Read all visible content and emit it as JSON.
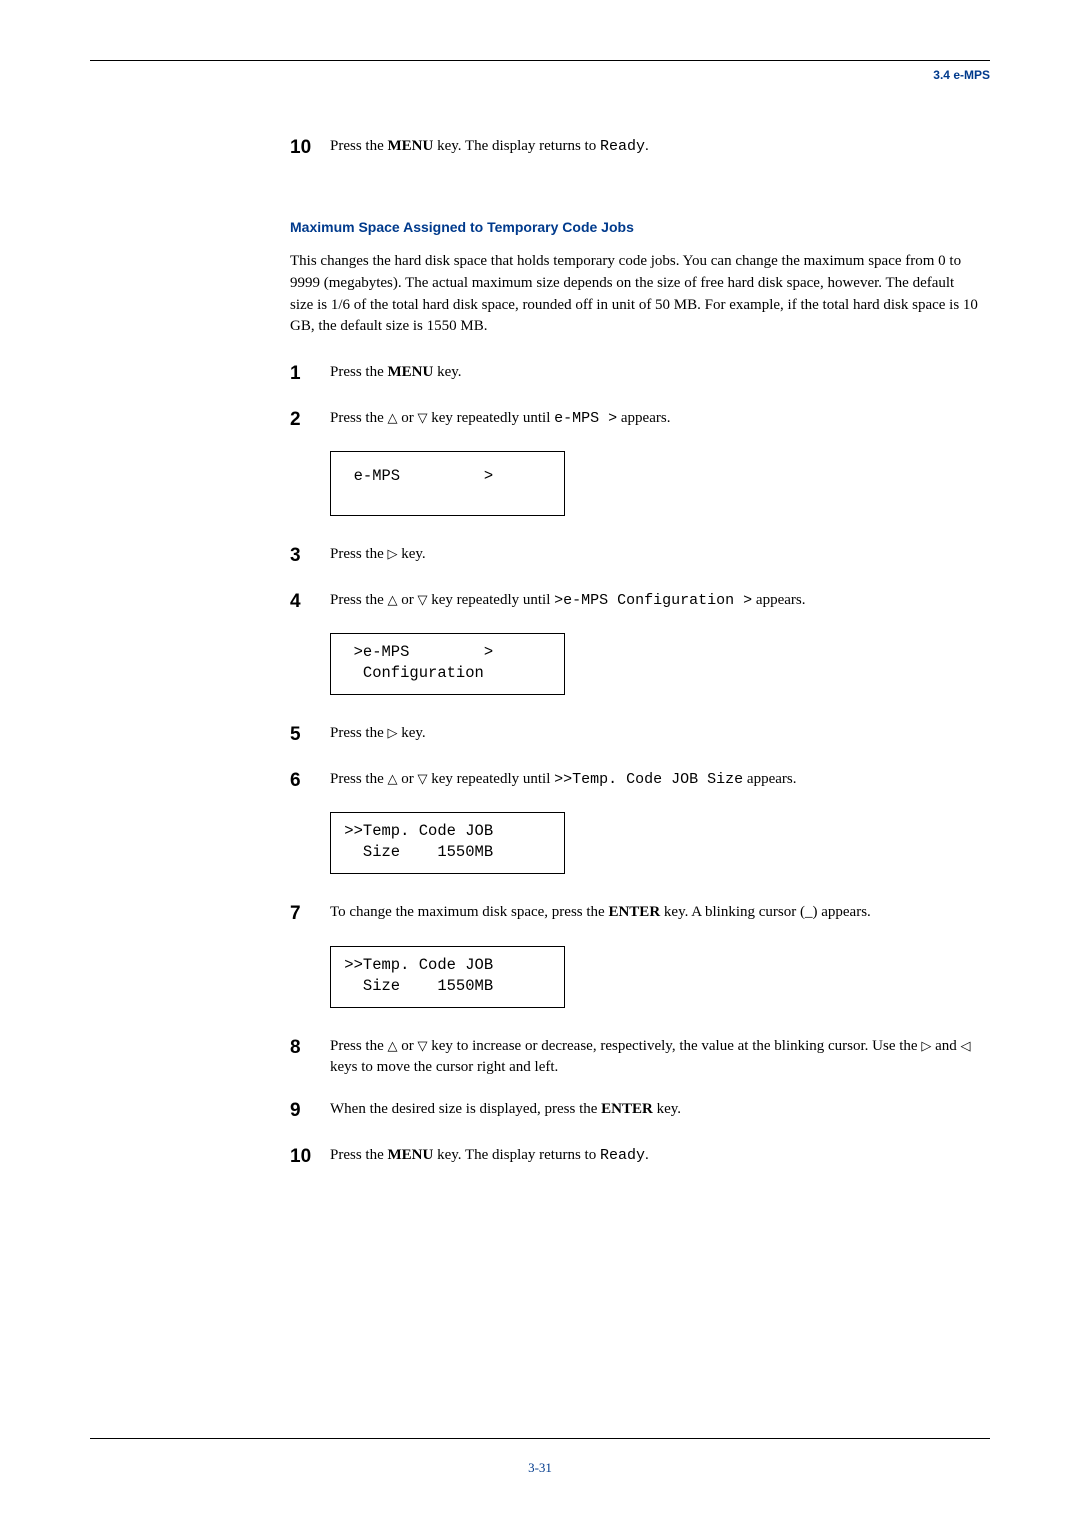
{
  "header": {
    "section_ref": "3.4 e-MPS"
  },
  "top_step": {
    "num": "10",
    "line": {
      "prefix": "Press the ",
      "bold": "MENU",
      "mid": " key. The display returns to ",
      "mono": "Ready",
      "suffix": "."
    }
  },
  "section": {
    "title": "Maximum Space Assigned to Temporary Code Jobs",
    "para": "This changes the hard disk space that holds temporary code jobs. You can change the maximum space from 0 to 9999 (megabytes). The actual maximum size depends on the size of free hard disk space, however. The default size is 1/6 of the total hard disk space, rounded off in unit of 50 MB. For example, if the total hard disk space is 10 GB, the default size is 1550 MB."
  },
  "steps": {
    "s1": {
      "num": "1",
      "prefix": "Press the ",
      "bold": "MENU",
      "suffix": " key."
    },
    "s2": {
      "num": "2",
      "prefix": "Press the ",
      "mid1": " or ",
      "mid2": " key repeatedly until ",
      "mono": "e-MPS >",
      "suffix": " appears."
    },
    "lcd1": "  e-MPS         >",
    "s3": {
      "num": "3",
      "prefix": "Press the ",
      "suffix": " key."
    },
    "s4": {
      "num": "4",
      "prefix": "Press the ",
      "mid1": " or ",
      "mid2": " key repeatedly until ",
      "mono1": ">",
      "mono2": "e-MPS Configuration >",
      "suffix": " appears."
    },
    "lcd2": "  >e-MPS        >\n   Configuration",
    "s5": {
      "num": "5",
      "prefix": "Press the ",
      "suffix": " key."
    },
    "s6": {
      "num": "6",
      "prefix": "Press the ",
      "mid1": " or ",
      "mid2": " key repeatedly until ",
      "mono": ">>Temp. Code JOB Size",
      "suffix": " appears."
    },
    "lcd3": " >>Temp. Code JOB\n   Size    1550MB",
    "s7": {
      "num": "7",
      "prefix": "To change the maximum disk space, press the ",
      "bold": "ENTER",
      "suffix": " key. A blinking cursor (_) appears."
    },
    "lcd4": " >>Temp. Code JOB\n   Size    1550MB",
    "s8": {
      "num": "8",
      "prefix": "Press the ",
      "mid1": " or ",
      "mid2": " key to increase or decrease, respectively, the value at the blinking cursor. Use the ",
      "mid3": " and ",
      "suffix": " keys to move the cursor right and left."
    },
    "s9": {
      "num": "9",
      "prefix": "When the desired size is displayed, press the ",
      "bold": "ENTER",
      "suffix": " key."
    },
    "s10": {
      "num": "10",
      "prefix": "Press the ",
      "bold": "MENU",
      "mid": " key. The display returns to ",
      "mono": "Ready",
      "suffix": "."
    }
  },
  "footer": {
    "page": "3-31"
  },
  "icons": {
    "tri_up": "△",
    "tri_down": "▽",
    "tri_right": "▷",
    "tri_left": "◁"
  }
}
